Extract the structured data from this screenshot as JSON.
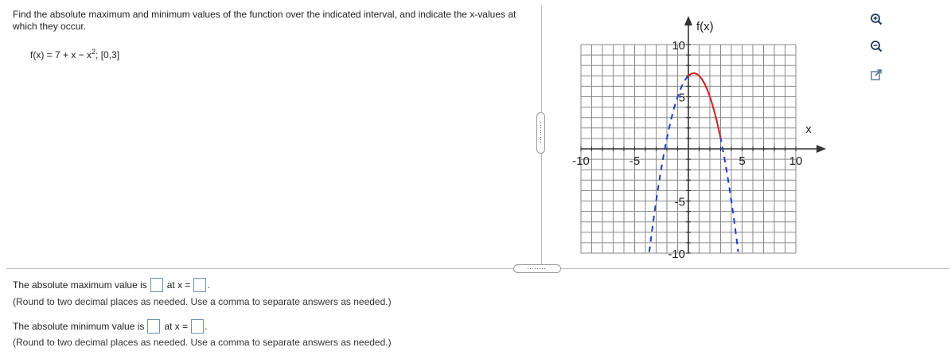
{
  "question": {
    "prompt": "Find the absolute maximum and minimum values of the function over the indicated interval, and indicate the x-values at which they occur.",
    "function_prefix": "f(x) = 7 + x − x",
    "function_exponent": "2",
    "function_suffix": "; [0,3]"
  },
  "answers": {
    "max_label": "The absolute maximum value is",
    "max_value": "",
    "max_at_label": "at x =",
    "max_x": "",
    "max_period": ".",
    "max_note": "(Round to two decimal places as needed. Use a comma to separate answers as needed.)",
    "min_label": "The absolute minimum value is",
    "min_value": "",
    "min_at_label": "at x =",
    "min_x": "",
    "min_period": ".",
    "min_note": "(Round to two decimal places as needed. Use a comma to separate answers as needed.)"
  },
  "graph": {
    "y_axis_label": "f(x)",
    "x_axis_label": "x",
    "x_ticks": [
      "-10",
      "-5",
      "5",
      "10"
    ],
    "y_ticks": [
      "10",
      "5",
      "-5",
      "-10"
    ],
    "curve_color": "#e02020",
    "dash_color": "#1a3fd0"
  },
  "tools": {
    "zoom_in": "zoom-in-icon",
    "zoom_out": "zoom-out-icon",
    "popout": "popout-icon"
  }
}
